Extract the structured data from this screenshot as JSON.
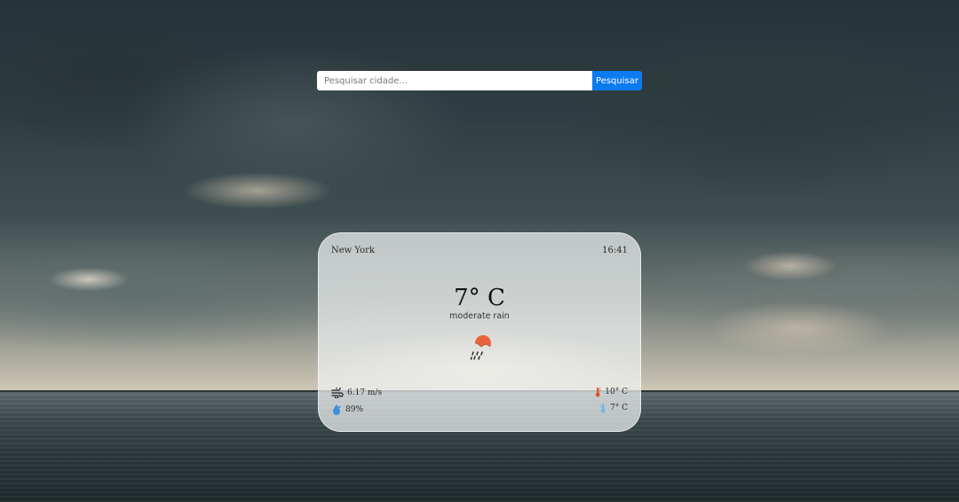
{
  "search": {
    "placeholder": "Pesquisar cidade...",
    "button_label": "Pesquisar"
  },
  "weather": {
    "city": "New York",
    "time": "16:41",
    "temperature": "7° C",
    "description": "moderate rain",
    "icon": "rain-cloud-icon",
    "wind": "6.17 m/s",
    "humidity": "89%",
    "temp_max": "10° C",
    "temp_min": "7° C"
  },
  "colors": {
    "search_button": "#0d7bf0",
    "icon_accent": "#e8643c",
    "humidity_icon": "#3d8fe0",
    "max_temp_icon": "#d9532f",
    "min_temp_icon": "#6fb6e6"
  }
}
